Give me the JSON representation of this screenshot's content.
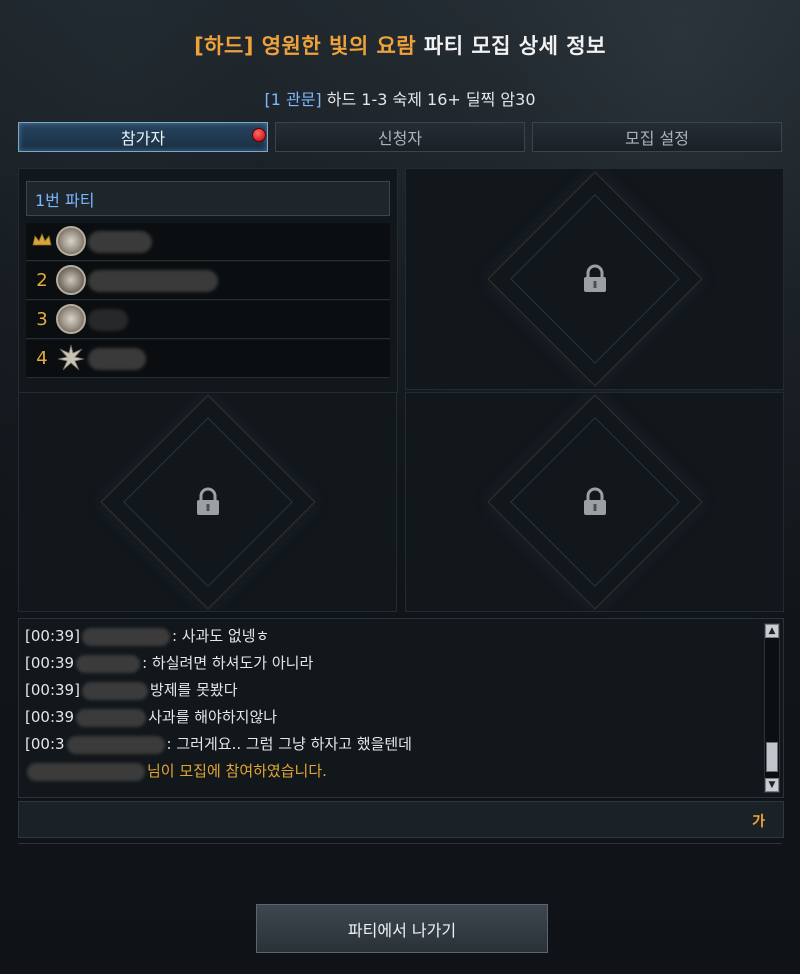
{
  "header": {
    "title_highlight": "[하드] 영원한 빛의 요람",
    "title_rest": " 파티 모집 상세 정보",
    "subtitle_tag": "[1 관문]",
    "subtitle_text": " 하드 1-3 숙제 16+ 딜찍 암30"
  },
  "tabs": [
    {
      "label": "참가자",
      "active": true,
      "notification": true
    },
    {
      "label": "신청자",
      "active": false
    },
    {
      "label": "모집 설정",
      "active": false
    }
  ],
  "party": {
    "name": "1번 파티",
    "members": [
      {
        "slot": "leader",
        "class_icon": "class-emblem-icon"
      },
      {
        "slot": "2",
        "class_icon": "class-emblem-icon"
      },
      {
        "slot": "3",
        "class_icon": "class-emblem-icon"
      },
      {
        "slot": "4",
        "class_icon": "class-emblem-icon"
      }
    ]
  },
  "locked_slots": 3,
  "chat": {
    "lines": [
      {
        "time": "[00:39]",
        "text": ": 사과도 없넹ㅎ"
      },
      {
        "time": "[00:39",
        "text": ": 하실려면 하셔도가 아니라"
      },
      {
        "time": "[00:39]",
        "text": "방제를 못봤다"
      },
      {
        "time": "[00:39",
        "text": "사과를 해야하지않나"
      },
      {
        "time": "[00:3",
        "text": ": 그러게요.. 그럼 그냥 하자고 했을텐데"
      }
    ],
    "system_message": "님이 모집에 참여하였습니다.",
    "input_value": "",
    "ime_indicator": "가"
  },
  "footer": {
    "leave_label": "파티에서 나가기"
  },
  "colors": {
    "accent_orange": "#f0a23a",
    "accent_blue": "#7fb6ff",
    "system_msg": "#e3a533"
  }
}
